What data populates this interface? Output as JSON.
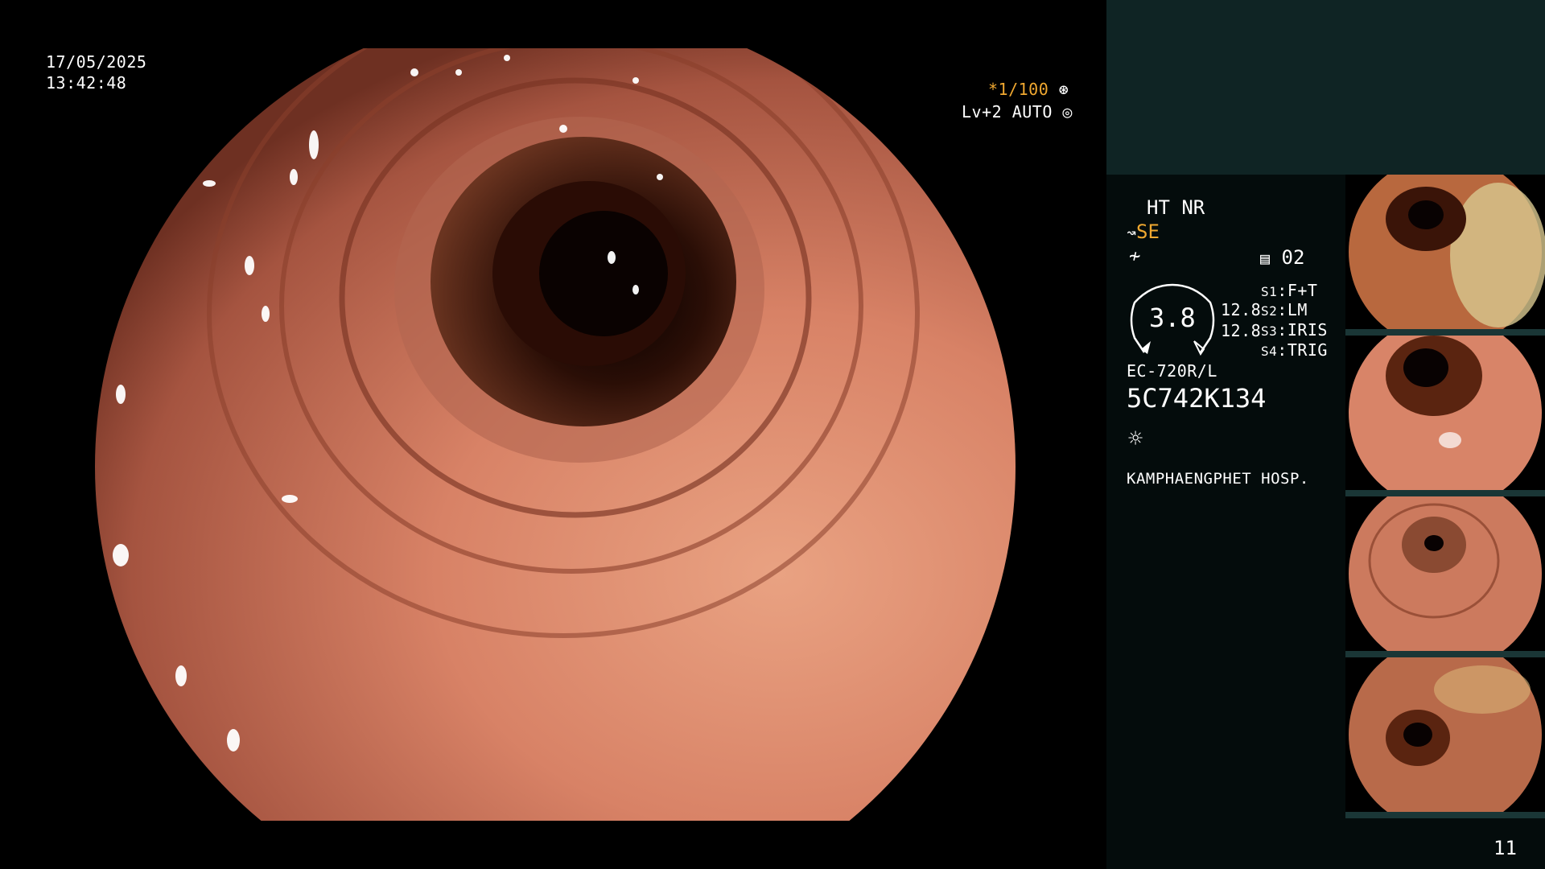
{
  "overlay": {
    "date": "17/05/2025",
    "time": "13:42:48",
    "shutter": "*1/100",
    "level": "Lv+2 AUTO"
  },
  "panel": {
    "ht_nr": "HT NR",
    "se": "SE",
    "memory": "02",
    "gauge_value": "3.8",
    "val1": "12.8",
    "val2": "12.8",
    "switches": [
      {
        "key": "S1",
        "value": "F+T"
      },
      {
        "key": "S2",
        "value": "LM"
      },
      {
        "key": "S3",
        "value": "IRIS"
      },
      {
        "key": "S4",
        "value": "TRIG"
      }
    ],
    "scope_model": "EC-720R/L",
    "serial": "5C742K134",
    "hospital": "KAMPHAENGPHET HOSP.",
    "image_count": "11"
  },
  "colors": {
    "mucosa": "#c8705a",
    "lumen": "#1a0805",
    "panel_top": "#0f2424",
    "panel_main": "#040c0c",
    "accent_orange": "#f0a830"
  },
  "icons": [
    "shutter-icon",
    "auto-iris-icon",
    "scope-tip-icon",
    "zigzag-icon",
    "memory-icon",
    "light-icon"
  ]
}
